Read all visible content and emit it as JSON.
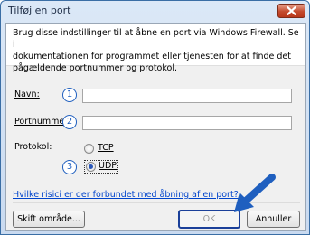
{
  "window": {
    "title": "Tilføj en port"
  },
  "intro": {
    "line1": "Brug disse indstillinger til at åbne en port via Windows Firewall. Se i",
    "line2": "dokumentationen for programmet eller tjenesten for at finde det",
    "line3": "pågældende portnummer og protokol."
  },
  "form": {
    "name_label": "Navn:",
    "name_value": "",
    "port_label": "Portnummer:",
    "port_value": "",
    "protocol_label": "Protokol:",
    "protocol_options": [
      "TCP",
      "UDP"
    ],
    "protocol_selected": "UDP"
  },
  "callouts": [
    "1",
    "2",
    "3"
  ],
  "link": {
    "text": "Hvilke risici er der forbundet med åbning af en port?"
  },
  "buttons": {
    "change_scope": "Skift område...",
    "ok": "OK",
    "cancel": "Annuller"
  },
  "colors": {
    "callout": "#1f5fbf",
    "arrow": "#1f5fbf",
    "link": "#0044cc"
  },
  "icons": {
    "close": "close-icon",
    "arrow": "pointer-arrow-icon"
  }
}
